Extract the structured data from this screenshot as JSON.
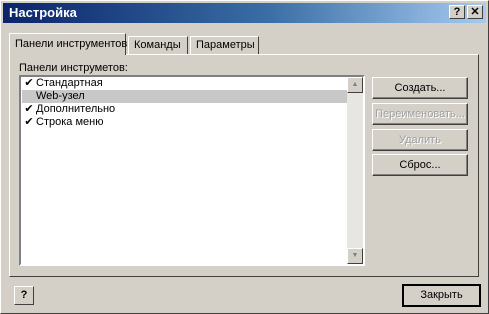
{
  "window": {
    "title": "Настройка",
    "help_glyph": "?",
    "close_glyph": "✕"
  },
  "tabs": [
    {
      "label": "Панели инструментов",
      "active": true
    },
    {
      "label": "Команды",
      "active": false
    },
    {
      "label": "Параметры",
      "active": false
    }
  ],
  "toolbars_panel": {
    "list_label": "Панели инструметов:",
    "items": [
      {
        "label": "Стандартная",
        "checked": true,
        "check_glyph": "✔"
      },
      {
        "label": "Web-узел",
        "checked": false,
        "check_glyph": ""
      },
      {
        "label": "Дополнительно",
        "checked": true,
        "check_glyph": "✔"
      },
      {
        "label": "Строка меню",
        "checked": true,
        "check_glyph": "✔"
      }
    ],
    "selected_index": 1,
    "scroll_up_glyph": "▲",
    "scroll_down_glyph": "▼"
  },
  "buttons": {
    "create": "Создать...",
    "rename": "Переименовать...",
    "delete": "Удалить",
    "reset": "Сброс..."
  },
  "footer": {
    "help_glyph": "?",
    "close_label": "Закрыть"
  }
}
